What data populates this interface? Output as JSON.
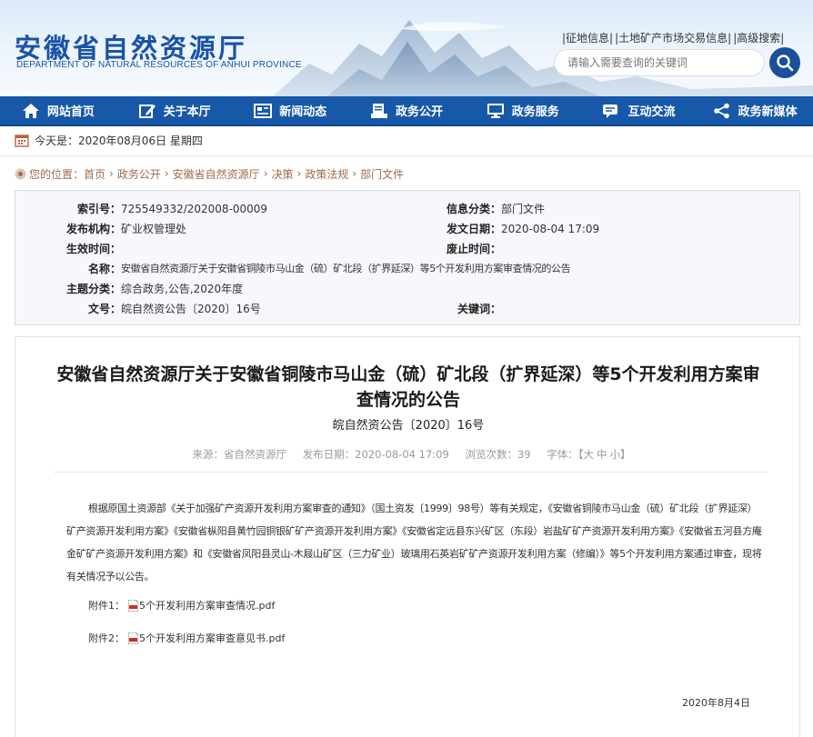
{
  "header": {
    "site_name": "安徽省自然资源厅",
    "site_name_en": "DEPARTMENT OF NATURAL RESOURCES OF ANHUI PROVINCE",
    "top_links": [
      "|征地信息|",
      "|土地矿产市场交易信息|",
      "|高级搜索|"
    ],
    "search_placeholder": "请输入需要查询的关键词"
  },
  "nav": {
    "items": [
      {
        "label": "网站首页",
        "icon": "home-icon"
      },
      {
        "label": "关于本厅",
        "icon": "edit-icon"
      },
      {
        "label": "新闻动态",
        "icon": "news-icon"
      },
      {
        "label": "政务公开",
        "icon": "document-icon"
      },
      {
        "label": "政务服务",
        "icon": "monitor-icon"
      },
      {
        "label": "互动交流",
        "icon": "chat-icon"
      },
      {
        "label": "政务新媒体",
        "icon": "share-icon"
      }
    ]
  },
  "date_bar": {
    "text": "今天是：2020年08月06日 星期四",
    "icon": "calendar-icon"
  },
  "breadcrumb": {
    "prefix": "您的位置：",
    "items": [
      "首页",
      "政务公开",
      "安徽省自然资源厅",
      "决策",
      "政策法规",
      "部门文件"
    ],
    "icon": "location-icon",
    "color": "#a06b4a"
  },
  "info": {
    "index_no_label": "索引号：",
    "index_no": "725549332/202008-00009",
    "category_label": "信息分类：",
    "category": "部门文件",
    "publisher_label": "发布机构：",
    "publisher": "矿业权管理处",
    "issue_date_label": "发文日期：",
    "issue_date": "2020-08-04 17:09",
    "effective_label": "生效时间：",
    "effective": "",
    "expire_label": "废止时间：",
    "expire": "",
    "name_label": "名称：",
    "name": "安徽省自然资源厅关于安徽省铜陵市马山金（硫）矿北段（扩界延深）等5个开发利用方案审查情况的公告",
    "topic_label": "主题分类：",
    "topic": "综合政务,公告,2020年度",
    "doc_no_label": "文号：",
    "doc_no": "皖自然资公告〔2020〕16号",
    "keywords_label": "关键词：",
    "keywords": ""
  },
  "article": {
    "title": "安徽省自然资源厅关于安徽省铜陵市马山金（硫）矿北段（扩界延深）等5个开发利用方案审查情况的公告",
    "doc_no": "皖自然资公告〔2020〕16号",
    "meta": {
      "source": "来源：省自然资源厅",
      "date": "发布日期：2020-08-04 17:09",
      "views": "浏览次数：39",
      "font_label": "字体：【",
      "font_large": "大",
      "font_medium": "中",
      "font_small": "小",
      "font_end": "】"
    },
    "paragraph": "根据原国土资源部《关于加强矿产资源开发利用方案审查的通知》（国土资发〔1999〕98号）等有关规定，《安徽省铜陵市马山金（硫）矿北段（扩界延深）矿产资源开发利用方案》《安徽省枞阳县黄竹园铜银矿矿产资源开发利用方案》《安徽省定远县东兴矿区（东段）岩盐矿矿产资源开发利用方案》《安徽省五河县方庵金矿矿产资源开发利用方案》和《安徽省凤阳县灵山-木屐山矿区（三力矿业）玻璃用石英岩矿矿产资源开发利用方案（修编）》等5个开发利用方案通过审查，现将有关情况予以公告。",
    "attachments": [
      {
        "label": "附件1：",
        "file": "5个开发利用方案审查情况.pdf",
        "icon": "pdf-icon"
      },
      {
        "label": "附件2：",
        "file": "5个开发利用方案审查意见书.pdf",
        "icon": "pdf-icon"
      }
    ],
    "signature_date": "2020年8月4日"
  },
  "colors": {
    "nav": "#1758a8",
    "brand": "#1a52a8",
    "search_button": "#1a4f9c"
  }
}
